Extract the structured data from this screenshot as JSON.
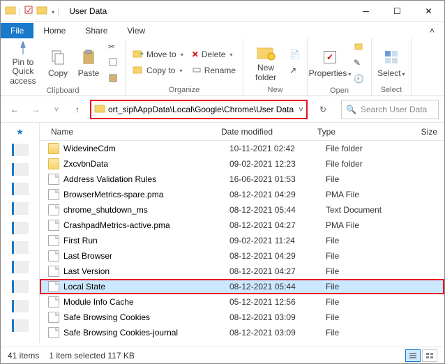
{
  "window": {
    "title": "User Data"
  },
  "tabs": {
    "file": "File",
    "home": "Home",
    "share": "Share",
    "view": "View"
  },
  "ribbon": {
    "clipboard": {
      "label": "Clipboard",
      "pin": "Pin to Quick\naccess",
      "copy": "Copy",
      "paste": "Paste"
    },
    "organize": {
      "label": "Organize",
      "moveto": "Move to",
      "copyto": "Copy to",
      "delete": "Delete",
      "rename": "Rename"
    },
    "new": {
      "label": "New",
      "newfolder": "New\nfolder"
    },
    "open": {
      "label": "Open",
      "properties": "Properties"
    },
    "select": {
      "label": "Select",
      "select": "Select"
    }
  },
  "address": {
    "path": "ort_sipl\\AppData\\Local\\Google\\Chrome\\User Data"
  },
  "search": {
    "placeholder": "Search User Data"
  },
  "columns": {
    "name": "Name",
    "date": "Date modified",
    "type": "Type",
    "size": "Size"
  },
  "rows": [
    {
      "icon": "folder",
      "name": "WidevineCdm",
      "date": "10-11-2021 02:42",
      "type": "File folder"
    },
    {
      "icon": "folder",
      "name": "ZxcvbnData",
      "date": "09-02-2021 12:23",
      "type": "File folder"
    },
    {
      "icon": "file",
      "name": "Address Validation Rules",
      "date": "16-06-2021 01:53",
      "type": "File"
    },
    {
      "icon": "file",
      "name": "BrowserMetrics-spare.pma",
      "date": "08-12-2021 04:29",
      "type": "PMA File"
    },
    {
      "icon": "file",
      "name": "chrome_shutdown_ms",
      "date": "08-12-2021 05:44",
      "type": "Text Document"
    },
    {
      "icon": "file",
      "name": "CrashpadMetrics-active.pma",
      "date": "08-12-2021 04:27",
      "type": "PMA File"
    },
    {
      "icon": "file",
      "name": "First Run",
      "date": "09-02-2021 11:24",
      "type": "File"
    },
    {
      "icon": "file",
      "name": "Last Browser",
      "date": "08-12-2021 04:29",
      "type": "File"
    },
    {
      "icon": "file",
      "name": "Last Version",
      "date": "08-12-2021 04:27",
      "type": "File"
    },
    {
      "icon": "file",
      "name": "Local State",
      "date": "08-12-2021 05:44",
      "type": "File",
      "selected": true
    },
    {
      "icon": "file",
      "name": "Module Info Cache",
      "date": "05-12-2021 12:56",
      "type": "File"
    },
    {
      "icon": "file",
      "name": "Safe Browsing Cookies",
      "date": "08-12-2021 03:09",
      "type": "File"
    },
    {
      "icon": "file",
      "name": "Safe Browsing Cookies-journal",
      "date": "08-12-2021 03:09",
      "type": "File"
    }
  ],
  "status": {
    "items": "41 items",
    "selection": "1 item selected  117 KB"
  }
}
